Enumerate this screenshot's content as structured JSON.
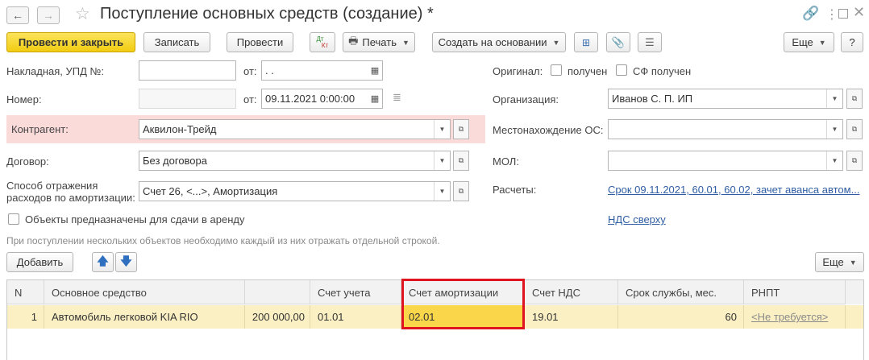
{
  "window": {
    "title": "Поступление основных средств (создание) *",
    "back_icon": "arrow-left-icon",
    "forward_icon": "arrow-right-icon",
    "favorite_icon": "star-icon",
    "link_icon": "link-icon",
    "menu_icon": "more-vertical-icon",
    "maximize_icon": "maximize-icon",
    "close_icon": "close-icon"
  },
  "toolbar": {
    "post_close": "Провести и закрыть",
    "save": "Записать",
    "post": "Провести",
    "dt_kt_top": "Дт",
    "dt_kt_bottom": "Кт",
    "print": "Печать",
    "create_based": "Создать на основании",
    "more": "Еще",
    "help": "?"
  },
  "form": {
    "invoice_label": "Накладная, УПД №:",
    "invoice_value": "",
    "from_label": "от:",
    "invoice_date": ". .",
    "number_label": "Номер:",
    "number_value": "",
    "date_value": "09.11.2021  0:00:00",
    "counterparty_label": "Контрагент:",
    "counterparty_value": "Аквилон-Трейд",
    "contract_label": "Договор:",
    "contract_value": "Без договора",
    "amort_label_line1": "Способ отражения",
    "amort_label_line2": "расходов по амортизации:",
    "amort_value": "Счет 26, <...>, Амортизация",
    "lease_label": "Объекты предназначены для сдачи в аренду",
    "lease_checked": false,
    "original_label": "Оригинал:",
    "received_label": "получен",
    "received_checked": false,
    "sf_received_label": "СФ получен",
    "sf_received_checked": false,
    "org_label": "Организация:",
    "org_value": "Иванов С. П. ИП",
    "location_label": "Местонахождение ОС:",
    "location_value": "",
    "mol_label": "МОЛ:",
    "mol_value": "",
    "settlements_label": "Расчеты:",
    "settlements_link": "Срок 09.11.2021, 60.01, 60.02, зачет аванса автом...",
    "vat_link": "НДС сверху",
    "hint": "При поступлении нескольких объектов необходимо каждый из них отражать отдельной строкой."
  },
  "table_toolbar": {
    "add": "Добавить",
    "up_icon": "arrow-up-icon",
    "down_icon": "arrow-down-icon",
    "more": "Еще"
  },
  "table": {
    "columns": [
      "N",
      "Основное средство",
      "",
      "Счет учета",
      "Счет амортизации",
      "Счет НДС",
      "Срок службы, мес.",
      "РНПТ"
    ],
    "rows": [
      {
        "n": "1",
        "asset": "Автомобиль легковой KIA RIO",
        "amount": "200 000,00",
        "account": "01.01",
        "amort_account": "02.01",
        "vat_account": "19.01",
        "life_months": "60",
        "rnpt": "<Не требуется>"
      }
    ]
  },
  "colors": {
    "primary_button": "#f2cc12",
    "highlight_row": "#fbf0c4",
    "counterparty_bg": "#fbdada",
    "annotation_box": "#e0141e",
    "link": "#2f5ea3"
  }
}
